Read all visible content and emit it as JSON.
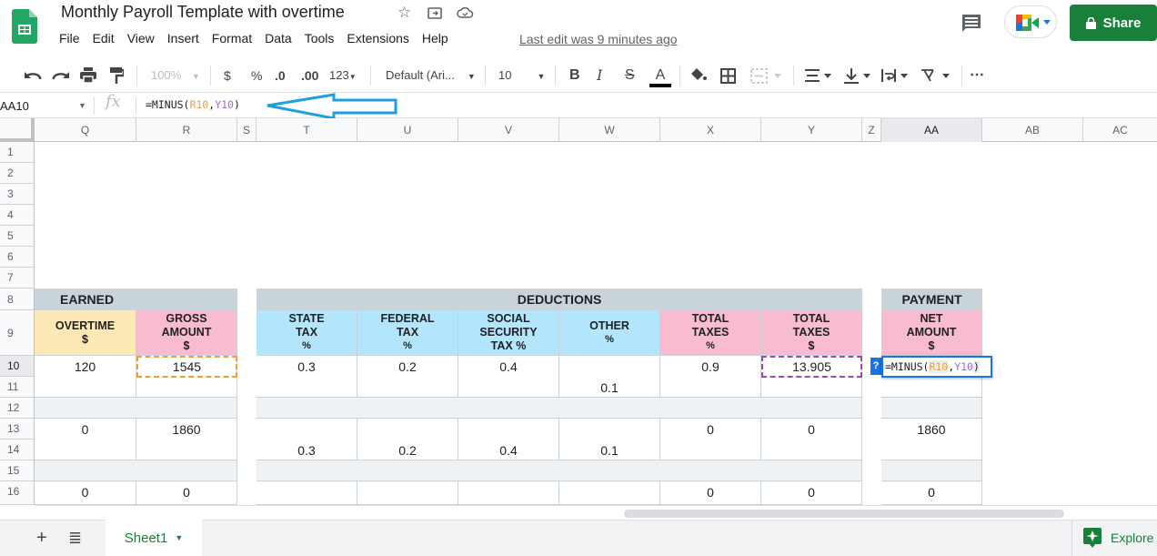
{
  "app": {
    "title": "Monthly Payroll Template with overtime",
    "last_edit": "Last edit was 9 minutes ago",
    "share_label": "Share",
    "menu": [
      "File",
      "Edit",
      "View",
      "Insert",
      "Format",
      "Data",
      "Tools",
      "Extensions",
      "Help"
    ]
  },
  "toolbar": {
    "zoom": "100%",
    "currency": "$",
    "percent": "%",
    "decrease_decimal": ".0",
    "increase_decimal": ".00",
    "more_formats": "123",
    "font": "Default (Ari...",
    "font_size": "10",
    "bold": "B",
    "italic": "I",
    "strikethrough": "S",
    "text_color": "A",
    "more": "⋯"
  },
  "formula_bar": {
    "name_box": "AA10",
    "fx": "fx",
    "formula_prefix": "=MINUS(",
    "ref1": "R10",
    "comma": ",",
    "ref2": "Y10",
    "formula_suffix": ")"
  },
  "columns": [
    "Q",
    "R",
    "S",
    "T",
    "U",
    "V",
    "W",
    "X",
    "Y",
    "Z",
    "AA",
    "AB",
    "AC"
  ],
  "rows": [
    "1",
    "2",
    "3",
    "4",
    "5",
    "6",
    "7",
    "8",
    "9",
    "10",
    "11",
    "12",
    "13",
    "14",
    "15",
    "16"
  ],
  "sections": {
    "earned": "EARNED",
    "deductions": "DEDUCTIONS",
    "payment": "PAYMENT"
  },
  "headers": {
    "overtime": [
      "OVERTIME",
      "$"
    ],
    "gross": [
      "GROSS",
      "AMOUNT",
      "$"
    ],
    "state_tax": [
      "STATE",
      "TAX",
      "%"
    ],
    "federal_tax": [
      "FEDERAL",
      "TAX",
      "%"
    ],
    "social_security": [
      "SOCIAL",
      "SECURITY",
      "TAX %"
    ],
    "other": [
      "OTHER",
      "%"
    ],
    "total_taxes_pct": [
      "TOTAL",
      "TAXES",
      "%"
    ],
    "total_taxes_usd": [
      "TOTAL",
      "TAXES",
      "$"
    ],
    "net_amount": [
      "NET",
      "AMOUNT",
      "$"
    ]
  },
  "records": [
    {
      "overtime": "120",
      "gross": "1545",
      "state": "0.3",
      "federal": "0.2",
      "social": "0.4",
      "other": "0.1",
      "total_pct": "0.9",
      "total_usd": "13.905",
      "net": "=MINUS(R10,Y10)"
    },
    {
      "overtime": "0",
      "gross": "1860",
      "state": "0.3",
      "federal": "0.2",
      "social": "0.4",
      "other": "0.1",
      "total_pct": "0",
      "total_usd": "0",
      "net": "1860"
    },
    {
      "overtime": "0",
      "gross": "0",
      "state": "",
      "federal": "",
      "social": "",
      "other": "",
      "total_pct": "0",
      "total_usd": "0",
      "net": "0"
    }
  ],
  "cell_editor": {
    "help": "?"
  },
  "sheets": [
    {
      "name": "Sheet1",
      "active": true
    }
  ],
  "explore_label": "Explore",
  "colors": {
    "brand_green": "#188038",
    "accent_blue": "#1a73e8",
    "annotation_arrow": "#1ea0e0"
  }
}
